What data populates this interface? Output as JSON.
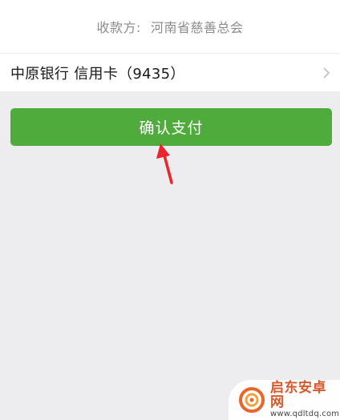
{
  "payee": {
    "prefix": "收款方:",
    "name": "河南省慈善总会"
  },
  "payment_method": {
    "label": "中原银行 信用卡（9435）"
  },
  "confirm_button": {
    "label": "确认支付"
  },
  "watermark": {
    "title": "启东安卓网",
    "url": "www.qdltdq.com"
  },
  "colors": {
    "accent": "#4fac3c",
    "annotation_arrow": "#e8262b",
    "background": "#ededf0"
  }
}
